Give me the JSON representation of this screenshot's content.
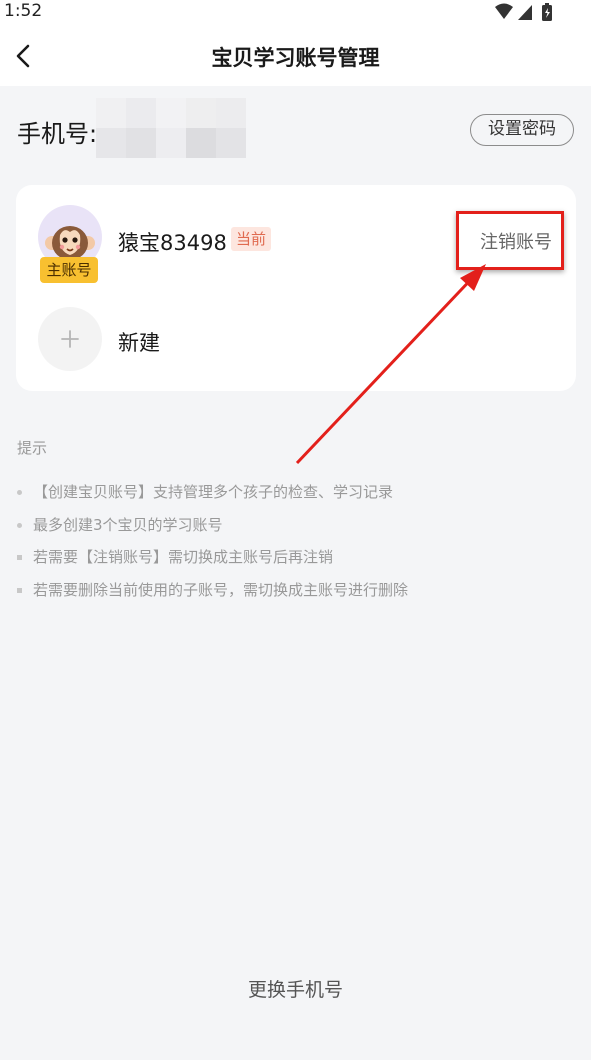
{
  "status_bar": {
    "time": "1:52",
    "icons": [
      "wifi-icon",
      "cell-signal-icon",
      "battery-icon"
    ]
  },
  "header": {
    "title": "宝贝学习账号管理",
    "back_icon": "back-chevron-icon"
  },
  "phone": {
    "label": "手机号:",
    "set_password_label": "设置密码"
  },
  "accounts": {
    "current": {
      "name": "猿宝83498",
      "tag": "当前",
      "role_badge": "主账号",
      "cancel_label": "注销账号",
      "avatar_icon": "monkey-avatar-icon"
    },
    "new_label": "新建",
    "add_icon": "plus-icon"
  },
  "tips": {
    "title": "提示",
    "items": [
      "【创建宝贝账号】支持管理多个孩子的检查、学习记录",
      "最多创建3个宝贝的学习账号",
      "若需要【注销账号】需切换成主账号后再注销",
      "若需要删除当前使用的子账号，需切换成主账号进行删除"
    ]
  },
  "footer": {
    "change_phone_label": "更换手机号"
  },
  "colors": {
    "annotation_red": "#e3201b",
    "badge_yellow": "#f8c030",
    "current_tag_bg": "#fde6df",
    "current_tag_text": "#e06a4f",
    "page_bg": "#f4f5f7"
  }
}
